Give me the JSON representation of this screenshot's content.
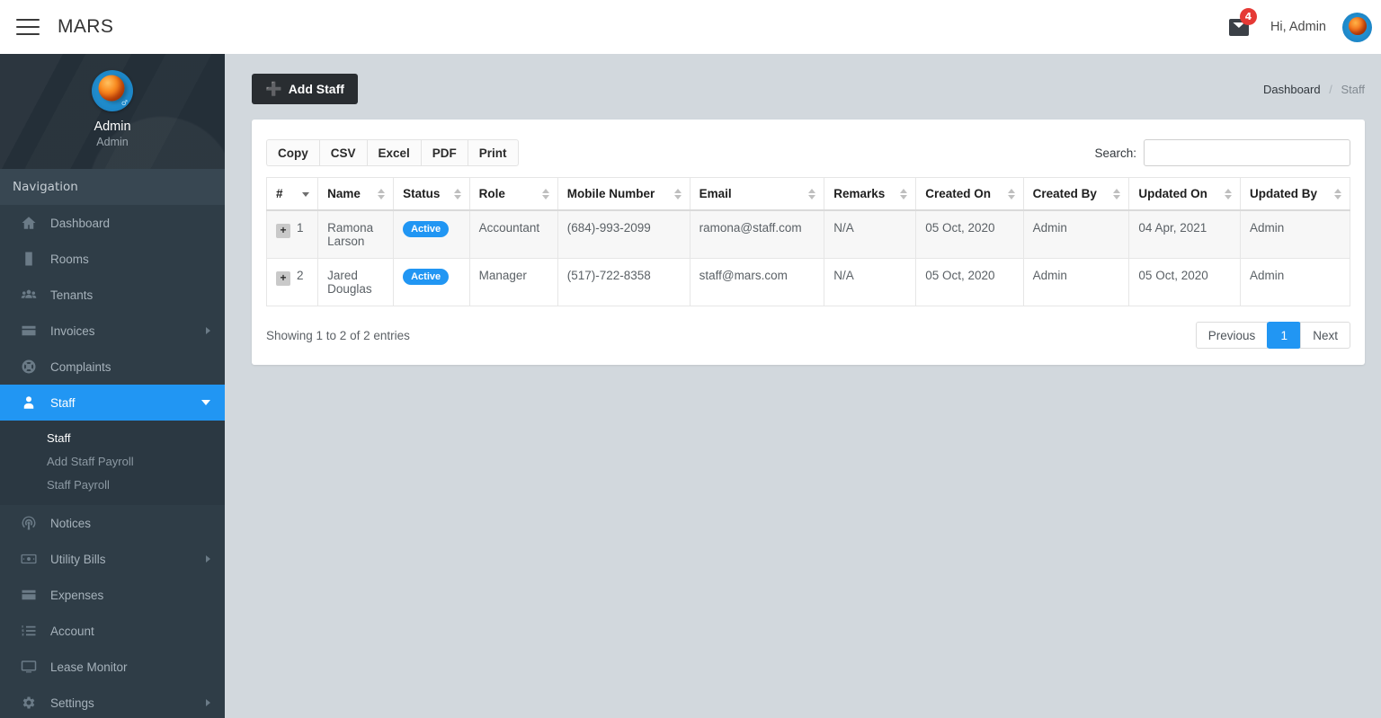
{
  "header": {
    "menu_icon": "hamburger-icon",
    "brand": "MARS",
    "notification_icon": "inbox-icon",
    "notification_count": "4",
    "greeting": "Hi, Admin",
    "avatar_icon": "mars-planet-avatar"
  },
  "sidebar": {
    "profile": {
      "avatar_icon": "mars-planet-avatar",
      "name": "Admin",
      "role": "Admin"
    },
    "nav_title": "Navigation",
    "items": [
      {
        "label": "Dashboard",
        "icon": "home-icon",
        "has_children": false,
        "active": false
      },
      {
        "label": "Rooms",
        "icon": "building-icon",
        "has_children": false,
        "active": false
      },
      {
        "label": "Tenants",
        "icon": "users-icon",
        "has_children": false,
        "active": false
      },
      {
        "label": "Invoices",
        "icon": "card-icon",
        "has_children": true,
        "active": false
      },
      {
        "label": "Complaints",
        "icon": "lifebuoy-icon",
        "has_children": false,
        "active": false
      },
      {
        "label": "Staff",
        "icon": "user-icon",
        "has_children": true,
        "active": true
      },
      {
        "label": "Notices",
        "icon": "broadcast-icon",
        "has_children": false,
        "active": false
      },
      {
        "label": "Utility Bills",
        "icon": "money-icon",
        "has_children": true,
        "active": false
      },
      {
        "label": "Expenses",
        "icon": "card-icon",
        "has_children": false,
        "active": false
      },
      {
        "label": "Account",
        "icon": "list-ol-icon",
        "has_children": false,
        "active": false
      },
      {
        "label": "Lease Monitor",
        "icon": "monitor-icon",
        "has_children": false,
        "active": false
      },
      {
        "label": "Settings",
        "icon": "gear-icon",
        "has_children": true,
        "active": false
      }
    ],
    "staff_submenu": [
      {
        "label": "Staff",
        "current": true
      },
      {
        "label": "Add Staff Payroll",
        "current": false
      },
      {
        "label": "Staff Payroll",
        "current": false
      }
    ]
  },
  "toolbar": {
    "add_staff_label": "Add Staff",
    "add_icon": "plus-icon"
  },
  "breadcrumb": {
    "root": "Dashboard",
    "separator": "/",
    "current": "Staff"
  },
  "panel": {
    "export_buttons": [
      "Copy",
      "CSV",
      "Excel",
      "PDF",
      "Print"
    ],
    "search_label": "Search:",
    "search_value": "",
    "search_placeholder": ""
  },
  "table": {
    "columns": [
      {
        "label": "#",
        "sort": "desc"
      },
      {
        "label": "Name",
        "sort": "none"
      },
      {
        "label": "Status",
        "sort": "none"
      },
      {
        "label": "Role",
        "sort": "none"
      },
      {
        "label": "Mobile Number",
        "sort": "none"
      },
      {
        "label": "Email",
        "sort": "none"
      },
      {
        "label": "Remarks",
        "sort": "none"
      },
      {
        "label": "Created On",
        "sort": "none"
      },
      {
        "label": "Created By",
        "sort": "none"
      },
      {
        "label": "Updated On",
        "sort": "none"
      },
      {
        "label": "Updated By",
        "sort": "none"
      }
    ],
    "expand_glyph": "+",
    "rows": [
      {
        "num": "1",
        "name": "Ramona Larson",
        "status": "Active",
        "role": "Accountant",
        "mobile": "(684)-993-2099",
        "email": "ramona@staff.com",
        "remarks": "N/A",
        "created_on": "05 Oct, 2020",
        "created_by": "Admin",
        "updated_on": "04 Apr, 2021",
        "updated_by": "Admin"
      },
      {
        "num": "2",
        "name": "Jared Douglas",
        "status": "Active",
        "role": "Manager",
        "mobile": "(517)-722-8358",
        "email": "staff@mars.com",
        "remarks": "N/A",
        "created_on": "05 Oct, 2020",
        "created_by": "Admin",
        "updated_on": "05 Oct, 2020",
        "updated_by": "Admin"
      }
    ]
  },
  "footer": {
    "entries_info": "Showing 1 to 2 of 2 entries",
    "pagination": {
      "previous": "Previous",
      "pages": [
        "1"
      ],
      "current_page": "1",
      "next": "Next"
    }
  },
  "colors": {
    "accent": "#2196f3",
    "sidebar": "#2f3d47",
    "sidebar_dark": "#242f38",
    "content_bg": "#d2d8dd",
    "badge_red": "#e53935",
    "button_dark": "#292d31"
  }
}
